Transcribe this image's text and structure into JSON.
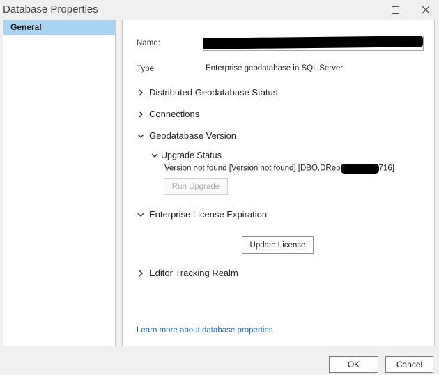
{
  "window": {
    "title": "Database Properties"
  },
  "sidebar": {
    "items": [
      {
        "label": "General",
        "selected": true
      }
    ]
  },
  "general": {
    "name_label": "Name:",
    "name_value": "",
    "type_label": "Type:",
    "type_value": "Enterprise geodatabase in SQL Server",
    "sections": {
      "distributed": "Distributed Geodatabase Status",
      "connections": "Connections",
      "gdb_version": "Geodatabase Version",
      "upgrade_status": "Upgrade Status",
      "version_text_prefix": "Version not found [Version not found] [DBO.DRep",
      "version_text_suffix": "716]",
      "license": "Enterprise License Expiration",
      "editor_tracking": "Editor Tracking Realm"
    },
    "buttons": {
      "run_upgrade": "Run Upgrade",
      "update_license": "Update License"
    },
    "learn_more_link": "Learn more about database properties"
  },
  "footer": {
    "ok": "OK",
    "cancel": "Cancel"
  },
  "icons": {
    "maximize": "maximize-icon",
    "close": "close-icon",
    "collapsed": "chevron-right-icon",
    "expanded": "chevron-down-icon"
  },
  "colors": {
    "selection": "#a9d3f3",
    "link": "#1a63a8",
    "background": "#f0f0f0"
  }
}
